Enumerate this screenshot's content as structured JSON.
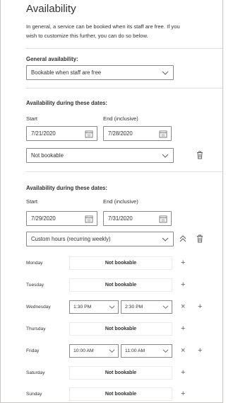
{
  "title": "Availability",
  "intro_lines": [
    "In general, a service can be booked when its staff are free. If you",
    "wish to customize this further, you can do so below."
  ],
  "general": {
    "heading": "General availability:",
    "value": "Bookable when staff are free"
  },
  "ranges": [
    {
      "heading": "Availability during these dates:",
      "start_label": "Start",
      "end_label": "End (inclusive)",
      "start": "7/21/2020",
      "end": "7/28/2020",
      "mode": "Not bookable"
    },
    {
      "heading": "Availability during these dates:",
      "start_label": "Start",
      "end_label": "End (inclusive)",
      "start": "7/29/2020",
      "end": "7/31/2020",
      "mode": "Custom hours (recurring weekly)"
    }
  ],
  "week": {
    "not_bookable": "Not bookable",
    "days": [
      {
        "name": "Monday"
      },
      {
        "name": "Tuesday"
      },
      {
        "name": "Wednesday",
        "from": "1:30 PM",
        "to": "2:30 PM"
      },
      {
        "name": "Thursday"
      },
      {
        "name": "Friday",
        "from": "10:00 AM",
        "to": "11:00 AM"
      },
      {
        "name": "Saturday"
      },
      {
        "name": "Sunday"
      }
    ]
  },
  "icons": {
    "add": "plus-icon",
    "remove": "close-icon",
    "delete": "trash-icon",
    "collapse": "chevron-up-double-icon",
    "dropdown": "chevron-down-icon",
    "calendar": "calendar-icon"
  }
}
